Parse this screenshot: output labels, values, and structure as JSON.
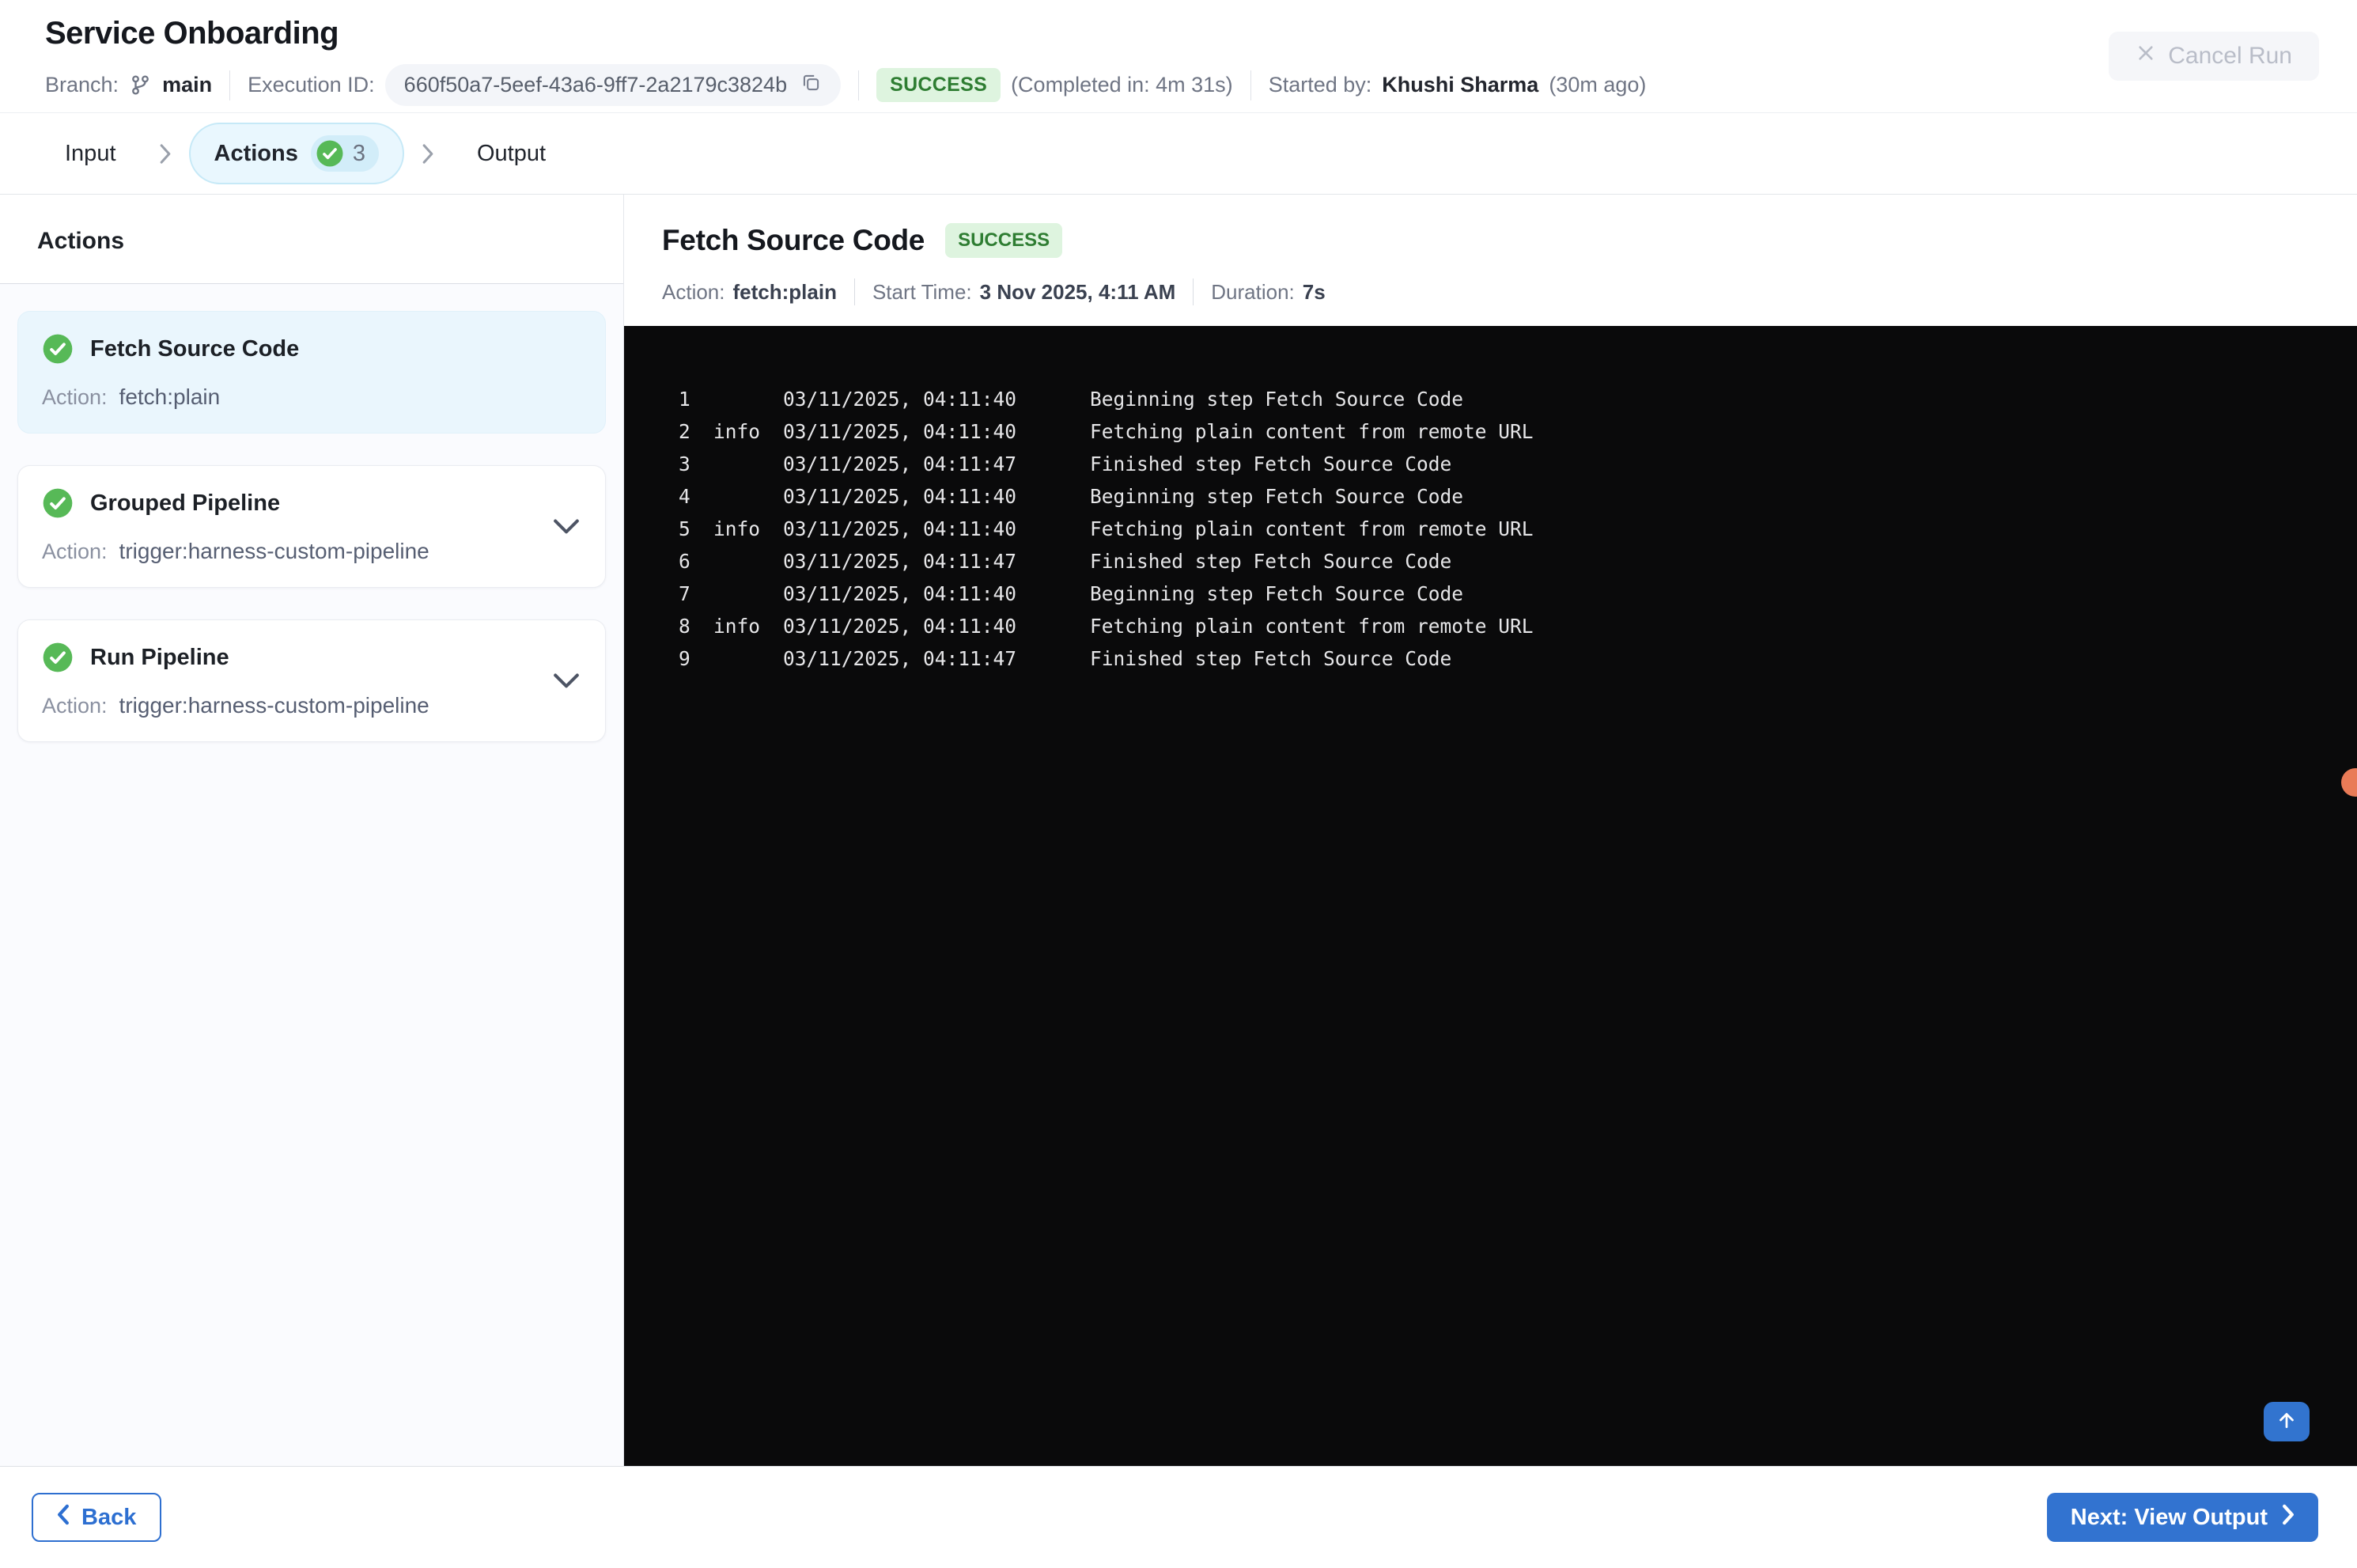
{
  "header": {
    "title": "Service Onboarding",
    "branch_label": "Branch:",
    "branch_name": "main",
    "execution_id_label": "Execution ID:",
    "execution_id": "660f50a7-5eef-43a6-9ff7-2a2179c3824b",
    "status": "SUCCESS",
    "completed_in": "(Completed in: 4m 31s)",
    "started_by_label": "Started by:",
    "started_by_name": "Khushi Sharma",
    "started_ago": "(30m ago)",
    "cancel_button": "Cancel Run"
  },
  "stepper": {
    "steps": [
      {
        "label": "Input",
        "active": false,
        "sep": true
      },
      {
        "label": "Actions",
        "active": true,
        "count": "3",
        "sep": true
      },
      {
        "label": "Output",
        "active": false
      }
    ]
  },
  "sidebar": {
    "heading": "Actions",
    "action_label": "Action:",
    "items": [
      {
        "title": "Fetch Source Code",
        "action": "fetch:plain",
        "selected": true,
        "expandable": false
      },
      {
        "title": "Grouped Pipeline",
        "action": "trigger:harness-custom-pipeline",
        "selected": false,
        "expandable": true
      },
      {
        "title": "Run Pipeline",
        "action": "trigger:harness-custom-pipeline",
        "selected": false,
        "expandable": true
      }
    ]
  },
  "detail": {
    "title": "Fetch Source Code",
    "status": "SUCCESS",
    "meta": [
      {
        "label": "Action:",
        "value": "fetch:plain"
      },
      {
        "label": "Start Time:",
        "value": "3 Nov 2025, 4:11 AM"
      },
      {
        "label": "Duration:",
        "value": "7s"
      }
    ]
  },
  "console": {
    "lines": [
      {
        "num": "1",
        "level": "",
        "time": "03/11/2025, 04:11:40",
        "message": "Beginning step Fetch Source Code"
      },
      {
        "num": "2",
        "level": "info",
        "time": "03/11/2025, 04:11:40",
        "message": "Fetching plain content from remote URL"
      },
      {
        "num": "3",
        "level": "",
        "time": "03/11/2025, 04:11:47",
        "message": "Finished step Fetch Source Code"
      },
      {
        "num": "4",
        "level": "",
        "time": "03/11/2025, 04:11:40",
        "message": "Beginning step Fetch Source Code"
      },
      {
        "num": "5",
        "level": "info",
        "time": "03/11/2025, 04:11:40",
        "message": "Fetching plain content from remote URL"
      },
      {
        "num": "6",
        "level": "",
        "time": "03/11/2025, 04:11:47",
        "message": "Finished step Fetch Source Code"
      },
      {
        "num": "7",
        "level": "",
        "time": "03/11/2025, 04:11:40",
        "message": "Beginning step Fetch Source Code"
      },
      {
        "num": "8",
        "level": "info",
        "time": "03/11/2025, 04:11:40",
        "message": "Fetching plain content from remote URL"
      },
      {
        "num": "9",
        "level": "",
        "time": "03/11/2025, 04:11:47",
        "message": "Finished step Fetch Source Code"
      }
    ]
  },
  "footer": {
    "back_label": "Back",
    "next_label": "Next: View Output"
  },
  "colors": {
    "accent_blue": "#3273d0",
    "success_green": "#57b957",
    "success_badge_bg": "#def4df",
    "success_badge_text": "#2e7d32",
    "active_tab_bg": "#e9f7fe",
    "active_tab_border": "#c6e9f7",
    "console_bg": "#0a0a0b",
    "coral_dot": "#e97b57"
  }
}
